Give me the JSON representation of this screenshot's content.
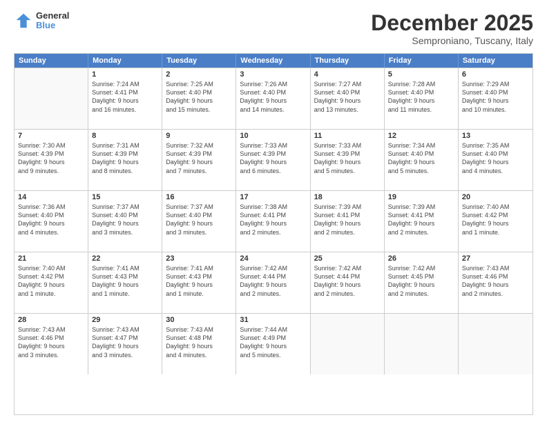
{
  "header": {
    "logo_line1": "General",
    "logo_line2": "Blue",
    "title": "December 2025",
    "subtitle": "Semproniano, Tuscany, Italy"
  },
  "calendar": {
    "days_of_week": [
      "Sunday",
      "Monday",
      "Tuesday",
      "Wednesday",
      "Thursday",
      "Friday",
      "Saturday"
    ],
    "rows": [
      [
        {
          "day": "",
          "info": ""
        },
        {
          "day": "1",
          "info": "Sunrise: 7:24 AM\nSunset: 4:41 PM\nDaylight: 9 hours\nand 16 minutes."
        },
        {
          "day": "2",
          "info": "Sunrise: 7:25 AM\nSunset: 4:40 PM\nDaylight: 9 hours\nand 15 minutes."
        },
        {
          "day": "3",
          "info": "Sunrise: 7:26 AM\nSunset: 4:40 PM\nDaylight: 9 hours\nand 14 minutes."
        },
        {
          "day": "4",
          "info": "Sunrise: 7:27 AM\nSunset: 4:40 PM\nDaylight: 9 hours\nand 13 minutes."
        },
        {
          "day": "5",
          "info": "Sunrise: 7:28 AM\nSunset: 4:40 PM\nDaylight: 9 hours\nand 11 minutes."
        },
        {
          "day": "6",
          "info": "Sunrise: 7:29 AM\nSunset: 4:40 PM\nDaylight: 9 hours\nand 10 minutes."
        }
      ],
      [
        {
          "day": "7",
          "info": "Sunrise: 7:30 AM\nSunset: 4:39 PM\nDaylight: 9 hours\nand 9 minutes."
        },
        {
          "day": "8",
          "info": "Sunrise: 7:31 AM\nSunset: 4:39 PM\nDaylight: 9 hours\nand 8 minutes."
        },
        {
          "day": "9",
          "info": "Sunrise: 7:32 AM\nSunset: 4:39 PM\nDaylight: 9 hours\nand 7 minutes."
        },
        {
          "day": "10",
          "info": "Sunrise: 7:33 AM\nSunset: 4:39 PM\nDaylight: 9 hours\nand 6 minutes."
        },
        {
          "day": "11",
          "info": "Sunrise: 7:33 AM\nSunset: 4:39 PM\nDaylight: 9 hours\nand 5 minutes."
        },
        {
          "day": "12",
          "info": "Sunrise: 7:34 AM\nSunset: 4:40 PM\nDaylight: 9 hours\nand 5 minutes."
        },
        {
          "day": "13",
          "info": "Sunrise: 7:35 AM\nSunset: 4:40 PM\nDaylight: 9 hours\nand 4 minutes."
        }
      ],
      [
        {
          "day": "14",
          "info": "Sunrise: 7:36 AM\nSunset: 4:40 PM\nDaylight: 9 hours\nand 4 minutes."
        },
        {
          "day": "15",
          "info": "Sunrise: 7:37 AM\nSunset: 4:40 PM\nDaylight: 9 hours\nand 3 minutes."
        },
        {
          "day": "16",
          "info": "Sunrise: 7:37 AM\nSunset: 4:40 PM\nDaylight: 9 hours\nand 3 minutes."
        },
        {
          "day": "17",
          "info": "Sunrise: 7:38 AM\nSunset: 4:41 PM\nDaylight: 9 hours\nand 2 minutes."
        },
        {
          "day": "18",
          "info": "Sunrise: 7:39 AM\nSunset: 4:41 PM\nDaylight: 9 hours\nand 2 minutes."
        },
        {
          "day": "19",
          "info": "Sunrise: 7:39 AM\nSunset: 4:41 PM\nDaylight: 9 hours\nand 2 minutes."
        },
        {
          "day": "20",
          "info": "Sunrise: 7:40 AM\nSunset: 4:42 PM\nDaylight: 9 hours\nand 1 minute."
        }
      ],
      [
        {
          "day": "21",
          "info": "Sunrise: 7:40 AM\nSunset: 4:42 PM\nDaylight: 9 hours\nand 1 minute."
        },
        {
          "day": "22",
          "info": "Sunrise: 7:41 AM\nSunset: 4:43 PM\nDaylight: 9 hours\nand 1 minute."
        },
        {
          "day": "23",
          "info": "Sunrise: 7:41 AM\nSunset: 4:43 PM\nDaylight: 9 hours\nand 1 minute."
        },
        {
          "day": "24",
          "info": "Sunrise: 7:42 AM\nSunset: 4:44 PM\nDaylight: 9 hours\nand 2 minutes."
        },
        {
          "day": "25",
          "info": "Sunrise: 7:42 AM\nSunset: 4:44 PM\nDaylight: 9 hours\nand 2 minutes."
        },
        {
          "day": "26",
          "info": "Sunrise: 7:42 AM\nSunset: 4:45 PM\nDaylight: 9 hours\nand 2 minutes."
        },
        {
          "day": "27",
          "info": "Sunrise: 7:43 AM\nSunset: 4:46 PM\nDaylight: 9 hours\nand 2 minutes."
        }
      ],
      [
        {
          "day": "28",
          "info": "Sunrise: 7:43 AM\nSunset: 4:46 PM\nDaylight: 9 hours\nand 3 minutes."
        },
        {
          "day": "29",
          "info": "Sunrise: 7:43 AM\nSunset: 4:47 PM\nDaylight: 9 hours\nand 3 minutes."
        },
        {
          "day": "30",
          "info": "Sunrise: 7:43 AM\nSunset: 4:48 PM\nDaylight: 9 hours\nand 4 minutes."
        },
        {
          "day": "31",
          "info": "Sunrise: 7:44 AM\nSunset: 4:49 PM\nDaylight: 9 hours\nand 5 minutes."
        },
        {
          "day": "",
          "info": ""
        },
        {
          "day": "",
          "info": ""
        },
        {
          "day": "",
          "info": ""
        }
      ]
    ]
  }
}
